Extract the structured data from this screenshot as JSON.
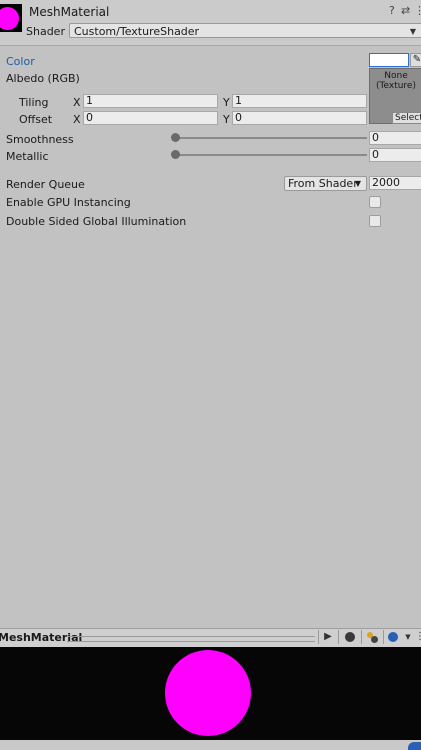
{
  "header": {
    "title": "MeshMaterial",
    "shader_label": "Shader",
    "shader_value": "Custom/TextureShader",
    "help_icon": "?",
    "settings_icon": "⇄",
    "menu_icon": "⋮"
  },
  "props": {
    "color_label": "Color",
    "albedo_label": "Albedo (RGB)",
    "tiling_label": "Tiling",
    "offset_label": "Offset",
    "x_label": "X",
    "y_label": "Y",
    "tiling_x": "1",
    "tiling_y": "1",
    "offset_x": "0",
    "offset_y": "0",
    "texture_none": "None",
    "texture_type": "(Texture)",
    "texture_select": "Select",
    "smoothness_label": "Smoothness",
    "smoothness_value": "0",
    "metallic_label": "Metallic",
    "metallic_value": "0"
  },
  "advanced": {
    "render_queue_label": "Render Queue",
    "render_queue_mode": "From Shader",
    "render_queue_value": "2000",
    "gpu_instancing_label": "Enable GPU Instancing",
    "double_sided_gi_label": "Double Sided Global Illumination"
  },
  "preview": {
    "title": "MeshMaterial"
  },
  "colors": {
    "material_color": "#ff00ff",
    "panel_bg": "#c2c2c2",
    "preview_bg": "#060606"
  }
}
